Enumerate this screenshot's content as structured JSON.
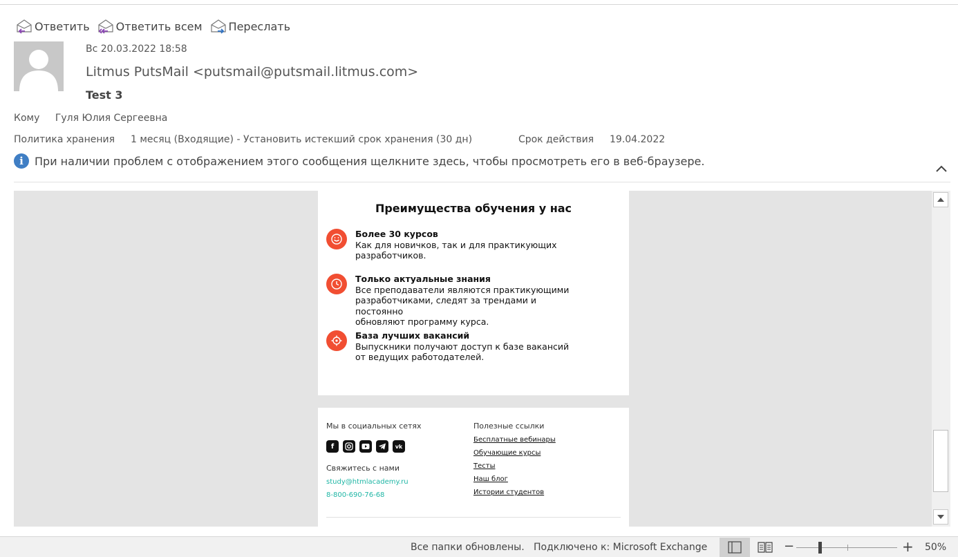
{
  "actions": [
    {
      "label": "Ответить",
      "icon": "reply-icon"
    },
    {
      "label": "Ответить всем",
      "icon": "reply-all-icon"
    },
    {
      "label": "Переслать",
      "icon": "forward-icon"
    }
  ],
  "message": {
    "date": "Вс 20.03.2022 18:58",
    "sender": "Litmus PutsMail <putsmail@putsmail.litmus.com>",
    "subject": "Test 3",
    "to_label": "Кому",
    "to_value": "Гуля Юлия Сергеевна",
    "policy_label": "Политика хранения",
    "policy_value": "1 месяц (Входящие) - Установить истекший срок хранения (30 дн)",
    "expiry_label": "Срок действия",
    "expiry_value": "19.04.2022",
    "info_text": "При наличии проблем с отображением этого сообщения щелкните здесь, чтобы просмотреть его в веб-браузере."
  },
  "email": {
    "title": "Преимущества обучения у нас",
    "features": [
      {
        "title": "Более 30 курсов",
        "desc": "Как для новичков, так и для практикующих\nразработчиков.",
        "icon": "smile-icon"
      },
      {
        "title": "Только актуальные знания",
        "desc": "Все преподаватели являются практикующими\nразработчиками, следят за трендами и постоянно\nобновляют программу курса.",
        "icon": "clock-icon"
      },
      {
        "title": "База лучших вакансий",
        "desc": "Выпускники получают доступ к базе вакансий\nот ведущих работодателей.",
        "icon": "target-icon"
      }
    ],
    "footer": {
      "social_title": "Мы в социальных сетях",
      "social": [
        "facebook-icon",
        "instagram-icon",
        "youtube-icon",
        "telegram-icon",
        "vk-icon"
      ],
      "contact_title": "Свяжитесь с нами",
      "email": "study@htmlacademy.ru",
      "phone": "8-800-690-76-68",
      "links_title": "Полезные ссылки",
      "links": [
        "Бесплатные вебинары",
        "Обучающие курсы",
        "Тесты",
        "Наш блог",
        "Истории студентов"
      ]
    }
  },
  "status": {
    "folders": "Все папки обновлены.",
    "connection": "Подключено к: Microsoft Exchange",
    "zoom": "50%",
    "zoom_level": 0.5
  },
  "colors": {
    "accent_red": "#f14e32",
    "link_teal": "#1fb6a5",
    "info_blue": "#3f7ec4"
  }
}
